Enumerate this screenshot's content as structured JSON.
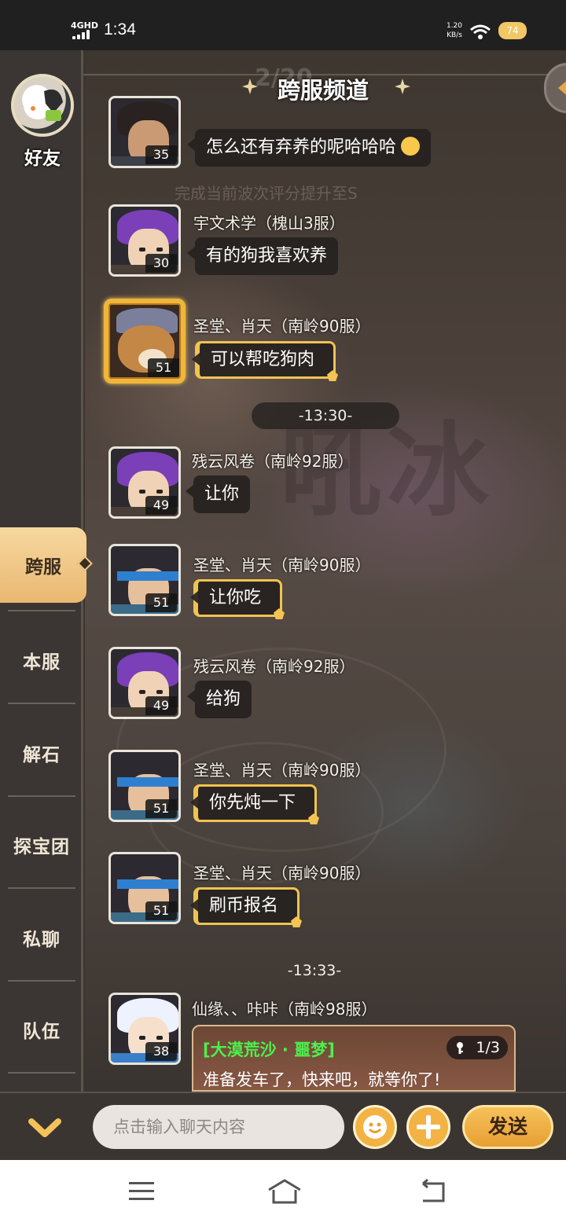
{
  "status_bar": {
    "network": "4GHD",
    "time": "1:34",
    "speed_value": "1.20",
    "speed_unit": "KB/s",
    "battery": "74"
  },
  "header": {
    "title": "跨服频道",
    "ghost_counter": "2/20"
  },
  "background": {
    "hint": "完成当前波次评分提升至S",
    "glyph": "吼冰"
  },
  "sidebar": {
    "friends_label": "好友",
    "active_tab": "跨服",
    "items": [
      "本服",
      "解石",
      "探宝团",
      "私聊",
      "队伍"
    ]
  },
  "messages": [
    {
      "name": "",
      "text": "怎么还有弃养的呢哈哈哈",
      "level": "35",
      "style": "normal",
      "emoji": "sweat-smile-emoji"
    },
    {
      "name": "宇文术学（槐山3服）",
      "text": "有的狗我喜欢养",
      "level": "30",
      "style": "normal"
    },
    {
      "name": "圣堂、肖天（南岭90服）",
      "text": "可以帮吃狗肉",
      "level": "51",
      "style": "gold"
    },
    {
      "name": "残云风卷（南岭92服）",
      "text": "让你",
      "level": "49",
      "style": "normal"
    },
    {
      "name": "圣堂、肖天（南岭90服）",
      "text": "让你吃",
      "level": "51",
      "style": "gold"
    },
    {
      "name": "残云风卷（南岭92服）",
      "text": "给狗",
      "level": "49",
      "style": "normal"
    },
    {
      "name": "圣堂、肖天（南岭90服）",
      "text": "你先炖一下",
      "level": "51",
      "style": "gold"
    },
    {
      "name": "圣堂、肖天（南岭90服）",
      "text": "刷币报名",
      "level": "51",
      "style": "gold"
    },
    {
      "name": "仙缘、、咔咔（南岭98服）",
      "text": "",
      "level": "38",
      "style": "invite"
    }
  ],
  "timestamps": [
    "-13:30-",
    "-13:33-"
  ],
  "invite": {
    "title": "[大漠荒沙 · 噩梦]",
    "count": "1/3",
    "text": "准备发车了，快来吧，就等你了!"
  },
  "input": {
    "placeholder": "点击输入聊天内容",
    "send_label": "发送"
  },
  "colors": {
    "accent": "#f2b344",
    "gold_border": "#efc350",
    "invite_title": "#4cf04c",
    "sidebar_bg": "#3b3633"
  }
}
